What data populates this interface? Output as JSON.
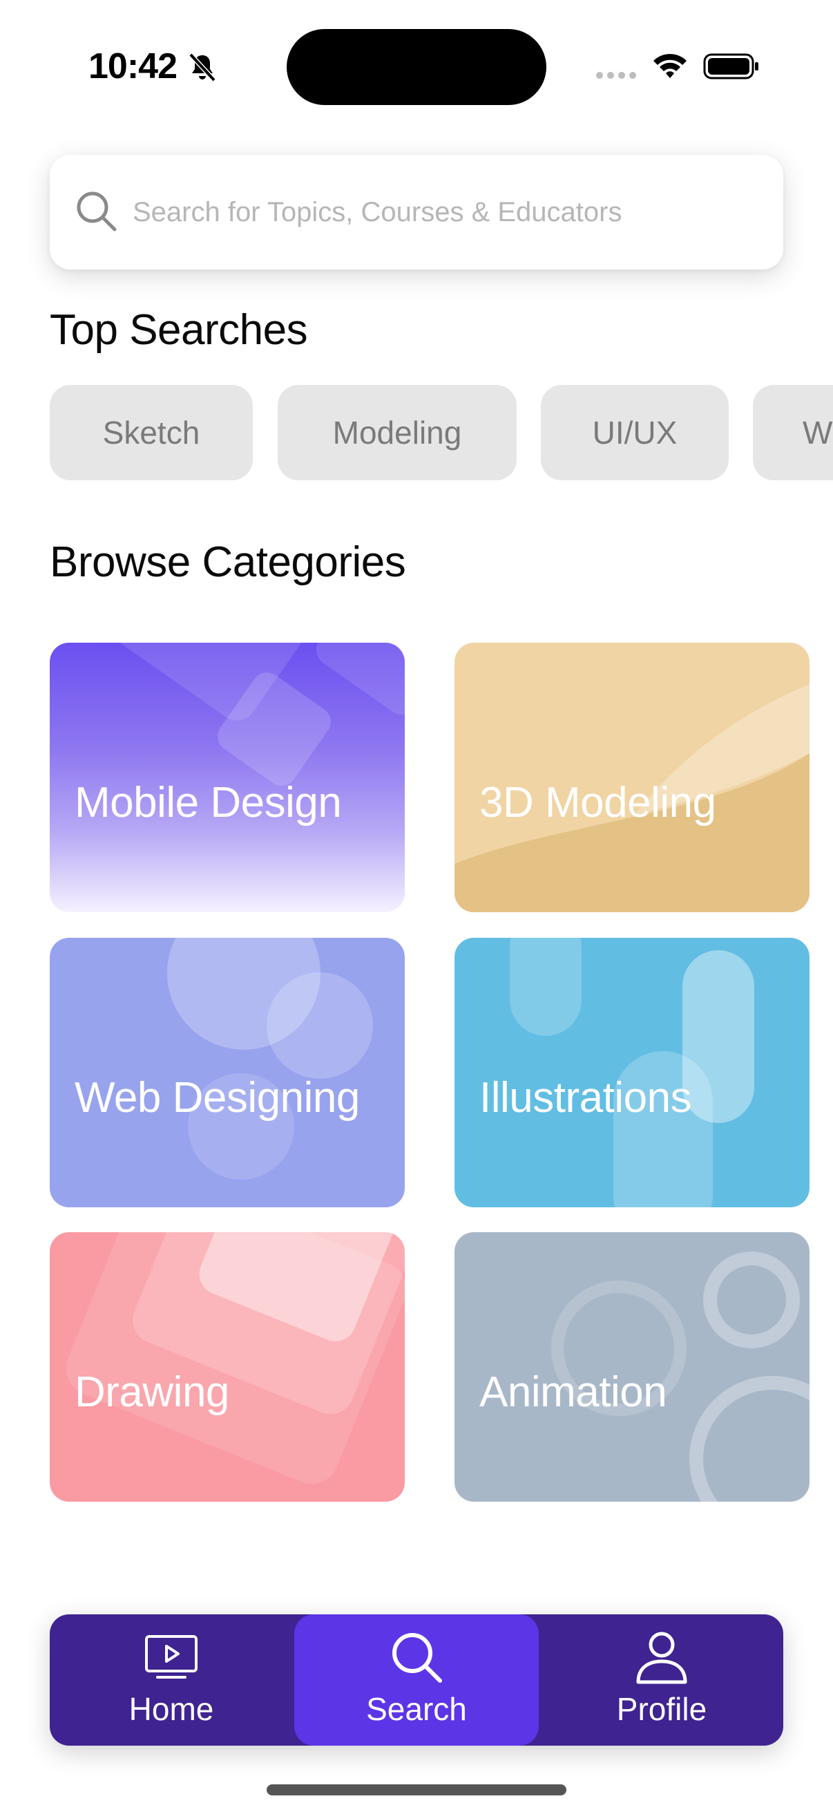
{
  "status_bar": {
    "time": "10:42"
  },
  "search": {
    "placeholder": "Search for Topics, Courses & Educators"
  },
  "top_searches": {
    "title": "Top Searches",
    "chips": [
      "Sketch",
      "Modeling",
      "UI/UX",
      "W"
    ]
  },
  "categories": {
    "title": "Browse Categories",
    "items": [
      {
        "label": "Mobile Design",
        "color": "#7b5cf0"
      },
      {
        "label": "3D Modeling",
        "color": "#f1d4a4"
      },
      {
        "label": "Web Designing",
        "color": "#98a3ee"
      },
      {
        "label": "Illustrations",
        "color": "#62bde3"
      },
      {
        "label": "Drawing",
        "color": "#fa9aa2"
      },
      {
        "label": "Animation",
        "color": "#a8b7c8"
      }
    ]
  },
  "bottom_nav": {
    "items": [
      {
        "label": "Home",
        "icon": "tv-play-icon"
      },
      {
        "label": "Search",
        "icon": "search-icon",
        "active": true
      },
      {
        "label": "Profile",
        "icon": "user-icon"
      }
    ]
  },
  "colors": {
    "nav_background": "#3f2390",
    "nav_active": "#5c35e6",
    "chip_background": "#e6e6e6"
  }
}
